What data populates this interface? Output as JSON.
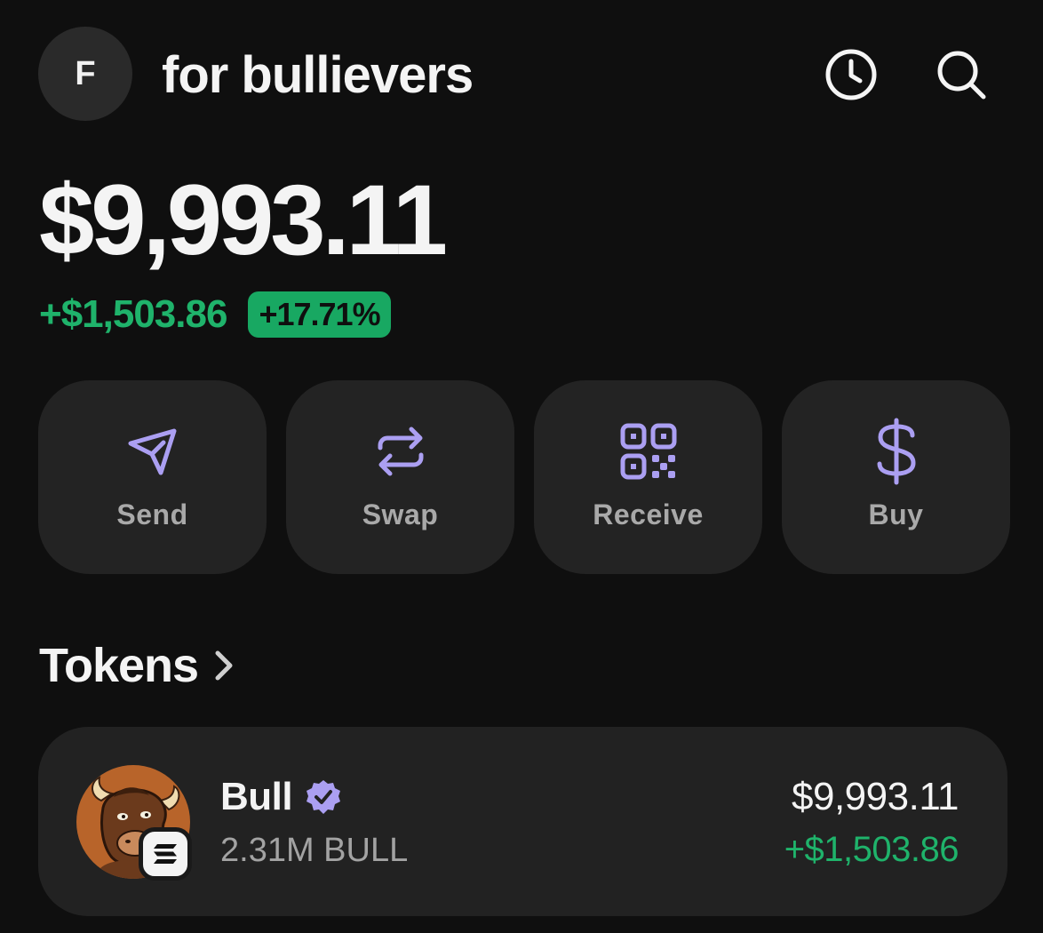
{
  "header": {
    "avatar_initial": "F",
    "account_name": "for bullievers",
    "history_icon": "clock-icon",
    "search_icon": "search-icon"
  },
  "portfolio": {
    "balance": "$9,993.11",
    "change_amount": "+$1,503.86",
    "change_percent": "+17.71%"
  },
  "actions": [
    {
      "label": "Send",
      "icon": "send-icon"
    },
    {
      "label": "Swap",
      "icon": "swap-icon"
    },
    {
      "label": "Receive",
      "icon": "qr-code-icon"
    },
    {
      "label": "Buy",
      "icon": "dollar-icon"
    }
  ],
  "tokens": {
    "title": "Tokens",
    "items": [
      {
        "name": "Bull",
        "verified": true,
        "quantity": "2.31M BULL",
        "value": "$9,993.11",
        "change": "+$1,503.86",
        "chain": "solana"
      }
    ]
  },
  "colors": {
    "background": "#0f0f0f",
    "card": "#232323",
    "accent_purple": "#ab9ff2",
    "positive_green": "#1fb36b"
  }
}
